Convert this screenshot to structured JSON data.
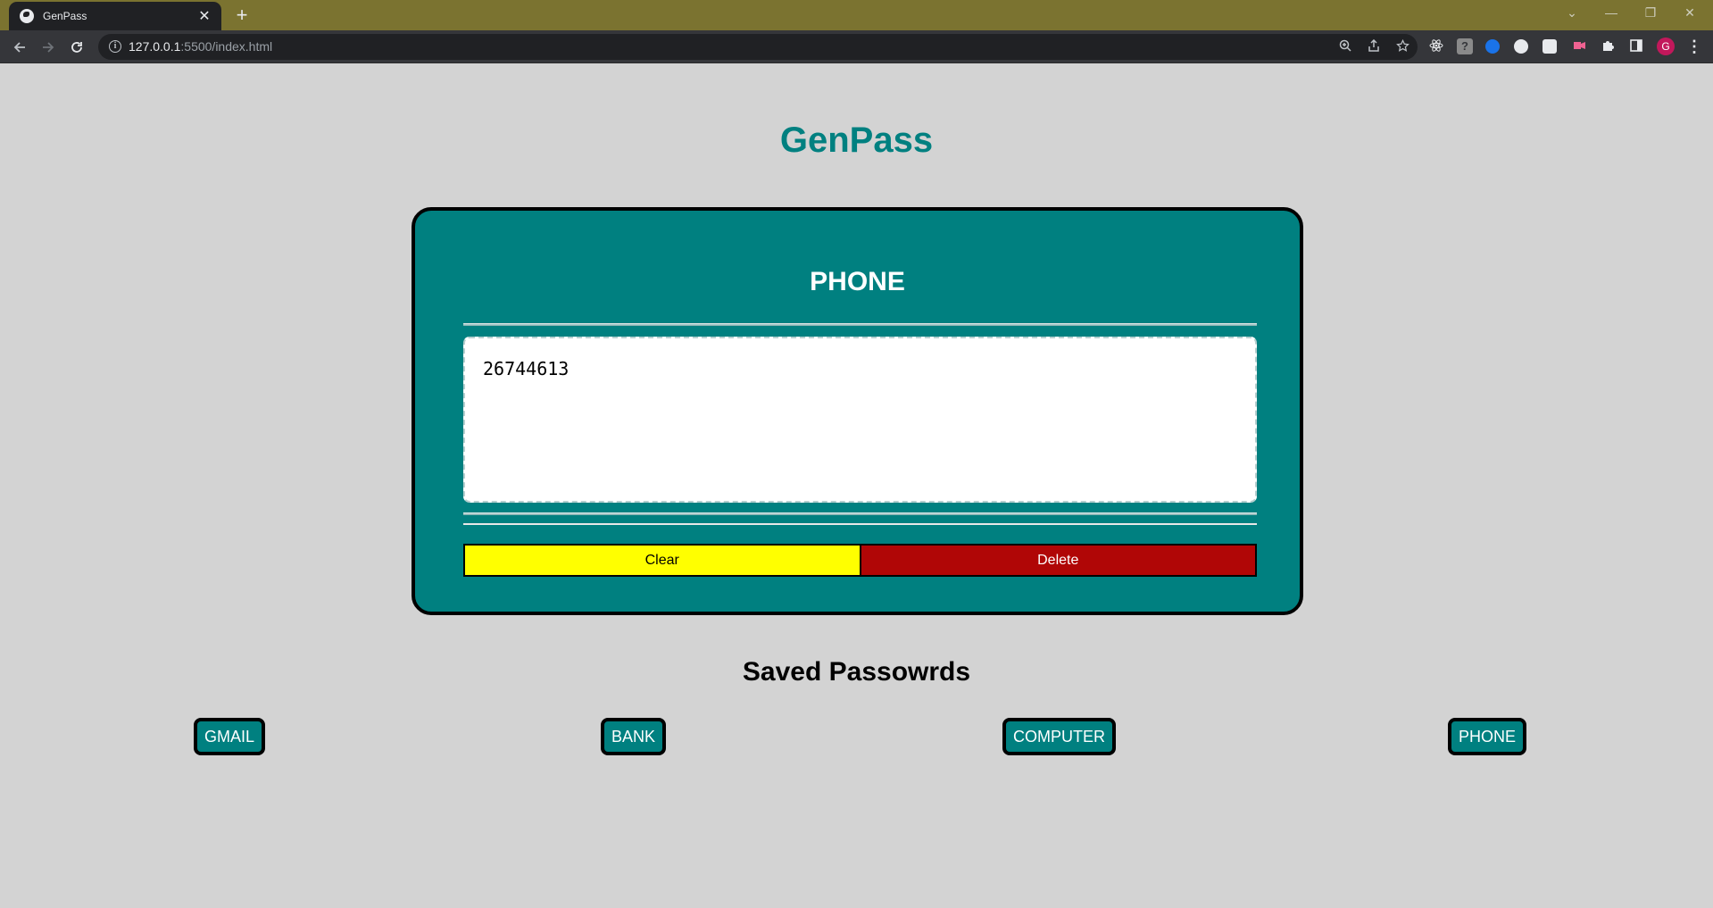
{
  "browser": {
    "tab_title": "GenPass",
    "tab_close": "✕",
    "new_tab": "+",
    "url_host": "127.0.0.1",
    "url_rest": ":5500/index.html",
    "profile_initial": "G",
    "window_controls": [
      "⌄",
      "—",
      "❐",
      "✕"
    ],
    "extension_icons": [
      "react-devtools-icon",
      "help-extension-icon",
      "vpn-extension-icon",
      "dark-mode-extension-icon",
      "screenshot-extension-icon",
      "recorder-extension-icon",
      "puzzle-extensions-icon",
      "side-panel-icon"
    ]
  },
  "app": {
    "title": "GenPass",
    "brand_color": "#008080"
  },
  "card": {
    "title": "PHONE",
    "password_value": "26744613",
    "clear_label": "Clear",
    "delete_label": "Delete",
    "clear_color": "#ffff00",
    "delete_color": "#b00606"
  },
  "saved": {
    "title": "Saved Passowrds",
    "items": [
      "GMAIL",
      "BANK",
      "COMPUTER",
      "PHONE"
    ]
  }
}
